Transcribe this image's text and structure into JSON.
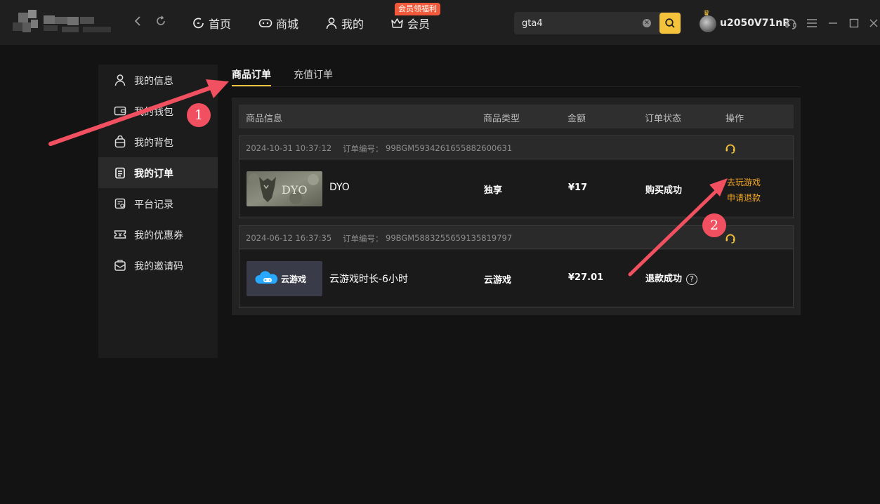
{
  "header": {
    "nav": {
      "home": "首页",
      "store": "商城",
      "mine": "我的",
      "vip": "会员",
      "vip_badge": "会员领福利"
    },
    "search": {
      "value": "gta4"
    },
    "user": {
      "name": "u2050V71nR"
    }
  },
  "sidebar": {
    "items": [
      {
        "label": "我的信息",
        "icon": "user-icon"
      },
      {
        "label": "我的钱包",
        "icon": "wallet-icon"
      },
      {
        "label": "我的背包",
        "icon": "backpack-icon"
      },
      {
        "label": "我的订单",
        "icon": "order-icon",
        "active": true
      },
      {
        "label": "平台记录",
        "icon": "record-icon"
      },
      {
        "label": "我的优惠券",
        "icon": "coupon-icon"
      },
      {
        "label": "我的邀请码",
        "icon": "invite-icon"
      }
    ]
  },
  "tabs": [
    "商品订单",
    "充值订单"
  ],
  "table": {
    "headers": [
      "商品信息",
      "商品类型",
      "金额",
      "订单状态",
      "操作"
    ],
    "order_no_label": "订单编号：",
    "orders": [
      {
        "date": "2024-10-31 10:37:12",
        "order_no": "99BGM5934261655882600631",
        "thumb_text": "DYO",
        "name": "DYO",
        "type": "独享",
        "price": "¥17",
        "status": "购买成功",
        "actions": [
          "去玩游戏",
          "申请退款"
        ]
      },
      {
        "date": "2024-06-12 16:37:35",
        "order_no": "99BGM5883255659135819797",
        "thumb_text": "云游戏",
        "name": "云游戏时长-6小时",
        "type": "云游戏",
        "price": "¥27.01",
        "status": "退款成功",
        "actions": []
      }
    ]
  },
  "annotations": {
    "one": "1",
    "two": "2"
  },
  "colors": {
    "accent": "#f5c33b",
    "action": "#f5a623",
    "marker": "#f0505f",
    "vip_badge": "#f05a3a"
  }
}
